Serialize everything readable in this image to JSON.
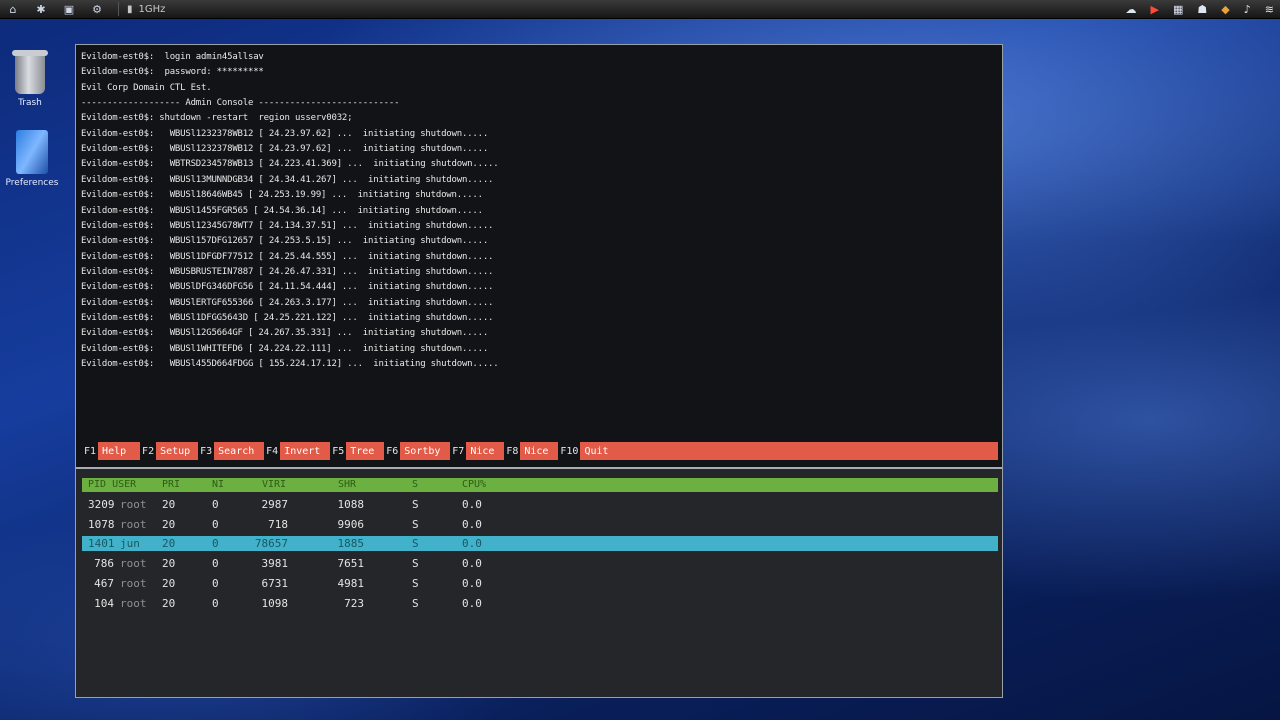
{
  "topbar": {
    "title": "1GHz",
    "icons": [
      "home-icon",
      "settings-icon",
      "terminal-icon",
      "gear-icon",
      "window-icon"
    ],
    "tray": [
      "cloud-icon",
      "play-icon",
      "grid-icon",
      "people-icon",
      "shield-icon",
      "volume-icon",
      "wifi-icon"
    ]
  },
  "desktop": {
    "trash_label": "Trash",
    "preferences_label": "Preferences"
  },
  "terminal": {
    "lines": [
      "Evildom-est0$:  login admin45allsav",
      "Evildom-est0$:  password: *********",
      "Evil Corp Domain CTL Est.",
      "------------------- Admin Console ---------------------------",
      "Evildom-est0$: shutdown -restart  region usserv0032;",
      "Evildom-est0$:   WBUSl1232378WB12 [ 24.23.97.62] ...  initiating shutdown.....",
      "Evildom-est0$:   WBUSl1232378WB12 [ 24.23.97.62] ...  initiating shutdown.....",
      "Evildom-est0$:   WBTRSD234578WB13 [ 24.223.41.369] ...  initiating shutdown.....",
      "Evildom-est0$:   WBUSl13MUNNDGB34 [ 24.34.41.267] ...  initiating shutdown.....",
      "Evildom-est0$:   WBUSl18646WB45 [ 24.253.19.99] ...  initiating shutdown.....",
      "Evildom-est0$:   WBUSl1455FGR565 [ 24.54.36.14] ...  initiating shutdown.....",
      "Evildom-est0$:   WBUSl12345G78WT7 [ 24.134.37.51] ...  initiating shutdown.....",
      "Evildom-est0$:   WBUSl157DFG12657 [ 24.253.5.15] ...  initiating shutdown.....",
      "Evildom-est0$:   WBUSl1DFGDF77512 [ 24.25.44.555] ...  initiating shutdown.....",
      "Evildom-est0$:   WBUSBRUSTEIN7887 [ 24.26.47.331] ...  initiating shutdown.....",
      "Evildom-est0$:   WBUSlDFG346DFG56 [ 24.11.54.444] ...  initiating shutdown.....",
      "Evildom-est0$:   WBUSlERTGF655366 [ 24.263.3.177] ...  initiating shutdown.....",
      "Evildom-est0$:   WBUSl1DFGG5643D [ 24.25.221.122] ...  initiating shutdown.....",
      "Evildom-est0$:   WBUSl12G5664GF [ 24.267.35.331] ...  initiating shutdown.....",
      "Evildom-est0$:   WBUSl1WHITEFD6 [ 24.224.22.111] ...  initiating shutdown.....",
      "Evildom-est0$:   WBUSl455D664FDGG [ 155.224.17.12] ...  initiating shutdown....."
    ]
  },
  "fkeys": [
    {
      "key": "F1",
      "label": "Help"
    },
    {
      "key": "F2",
      "label": "Setup"
    },
    {
      "key": "F3",
      "label": "Search"
    },
    {
      "key": "F4",
      "label": "Invert"
    },
    {
      "key": "F5",
      "label": "Tree"
    },
    {
      "key": "F6",
      "label": "Sortby"
    },
    {
      "key": "F7",
      "label": "Nice"
    },
    {
      "key": "F8",
      "label": "Nice"
    },
    {
      "key": "F10",
      "label": "Quit"
    }
  ],
  "process_table": {
    "headers": {
      "pid_user": "PID USER",
      "pri": "PRI",
      "ni": "NI",
      "virt": "VIRI",
      "shr": "SHR",
      "s": "S",
      "cpu": "CPU%"
    },
    "rows": [
      {
        "pid": "3209",
        "user": "root",
        "pri": "20",
        "ni": "0",
        "virt": "2987",
        "shr": "1088",
        "s": "S",
        "cpu": "0.0"
      },
      {
        "pid": "1078",
        "user": "root",
        "pri": "20",
        "ni": "0",
        "virt": "718",
        "shr": "9906",
        "s": "S",
        "cpu": "0.0"
      },
      {
        "pid": "1401",
        "user": "jun",
        "pri": "20",
        "ni": "0",
        "virt": "78657",
        "shr": "1885",
        "s": "S",
        "cpu": "0.0"
      },
      {
        "pid": "786",
        "user": "root",
        "pri": "20",
        "ni": "0",
        "virt": "3981",
        "shr": "7651",
        "s": "S",
        "cpu": "0.0"
      },
      {
        "pid": "467",
        "user": "root",
        "pri": "20",
        "ni": "0",
        "virt": "6731",
        "shr": "4981",
        "s": "S",
        "cpu": "0.0"
      },
      {
        "pid": "104",
        "user": "root",
        "pri": "20",
        "ni": "0",
        "virt": "1098",
        "shr": "723",
        "s": "S",
        "cpu": "0.0"
      }
    ]
  },
  "colors": {
    "fkey_bar": "#e25b48",
    "header_bar": "#6bb041",
    "selected_row": "#41b2c9"
  }
}
